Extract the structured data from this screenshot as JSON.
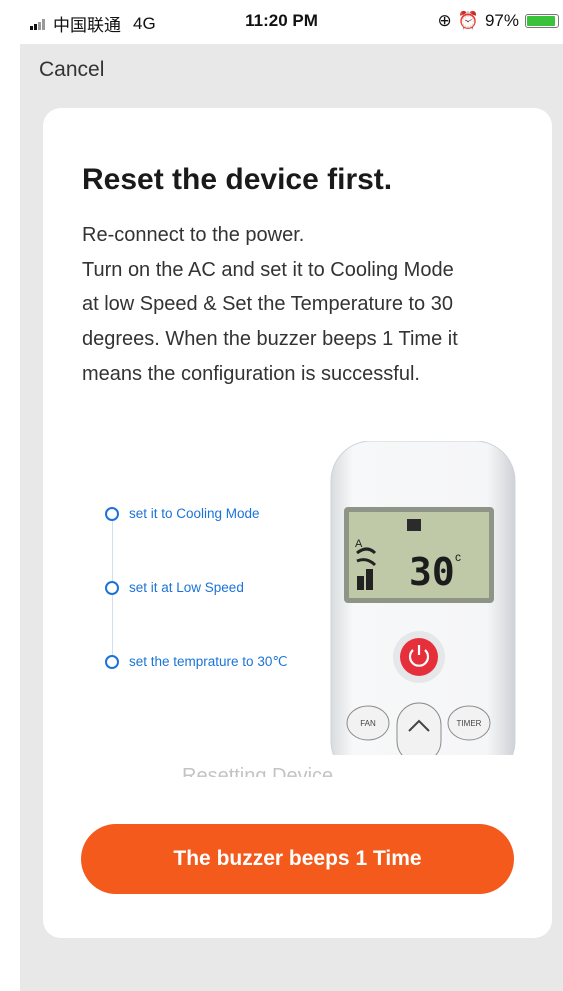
{
  "status_bar": {
    "carrier": "中国联通",
    "network": "4G",
    "time": "11:20 PM",
    "battery_percent": "97%",
    "icons": [
      "signal-icon",
      "rotation-lock-icon",
      "alarm-icon",
      "battery-icon"
    ]
  },
  "nav": {
    "cancel_label": "Cancel"
  },
  "card": {
    "title": "Reset the device first.",
    "description_lines": [
      "Re-connect to the power.",
      "Turn on the AC and set it to Cooling Mode",
      "at low Speed & Set the Temperature to 30",
      "degrees. When the buzzer beeps 1 Time it",
      "means the configuration is successful."
    ],
    "steps": [
      "set it to Cooling Mode",
      "set it at Low Speed",
      "set the temprature to 30℃"
    ],
    "remote": {
      "display_value": "30",
      "display_unit": "c",
      "mode_indicator": "A",
      "buttons": [
        "FAN",
        "^",
        "TIMER"
      ]
    },
    "faded_caption": "Resetting Device",
    "primary_button_label": "The buzzer beeps 1 Time"
  },
  "colors": {
    "accent_orange": "#f35a1c",
    "step_blue": "#1b73d9",
    "power_red": "#e5303b",
    "lcd_green": "#bfc9a8"
  }
}
